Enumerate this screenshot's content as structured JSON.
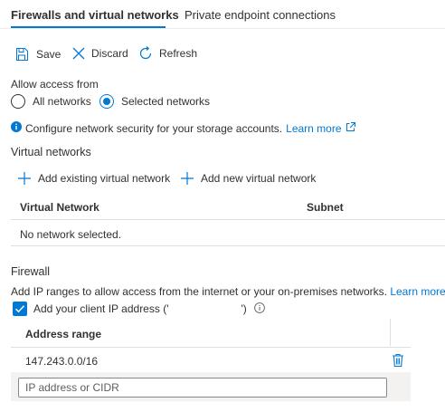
{
  "tabs": [
    {
      "label": "Firewalls and virtual networks",
      "active": true
    },
    {
      "label": "Private endpoint connections",
      "active": false
    }
  ],
  "toolbar": {
    "save_label": "Save",
    "discard_label": "Discard",
    "refresh_label": "Refresh"
  },
  "access": {
    "label": "Allow access from",
    "options": [
      {
        "label": "All networks",
        "selected": false
      },
      {
        "label": "Selected networks",
        "selected": true
      }
    ]
  },
  "info": {
    "text": "Configure network security for your storage accounts.",
    "link": "Learn more"
  },
  "virtual_networks": {
    "title": "Virtual networks",
    "add_existing_label": "Add existing virtual network",
    "add_new_label": "Add new virtual network",
    "columns": [
      "Virtual Network",
      "Subnet"
    ],
    "empty_message": "No network selected."
  },
  "firewall": {
    "title": "Firewall",
    "description": "Add IP ranges to allow access from the internet or your on-premises networks.",
    "learn_more": "Learn more.",
    "client_ip_label_prefix": "Add your client IP address ('",
    "client_ip_label_suffix": "')",
    "client_ip_checked": true,
    "column_header": "Address range",
    "rows": [
      {
        "address_range": "147.243.0.0/16"
      }
    ],
    "input_placeholder": "IP address or CIDR"
  },
  "colors": {
    "accent": "#0078d4",
    "text": "#323130",
    "divider": "#e1dfdd"
  },
  "icons": [
    "save-icon",
    "discard-icon",
    "refresh-icon",
    "info-icon",
    "external-link-icon",
    "plus-icon",
    "checkbox-check-icon",
    "info-circle-icon",
    "trash-icon"
  ]
}
